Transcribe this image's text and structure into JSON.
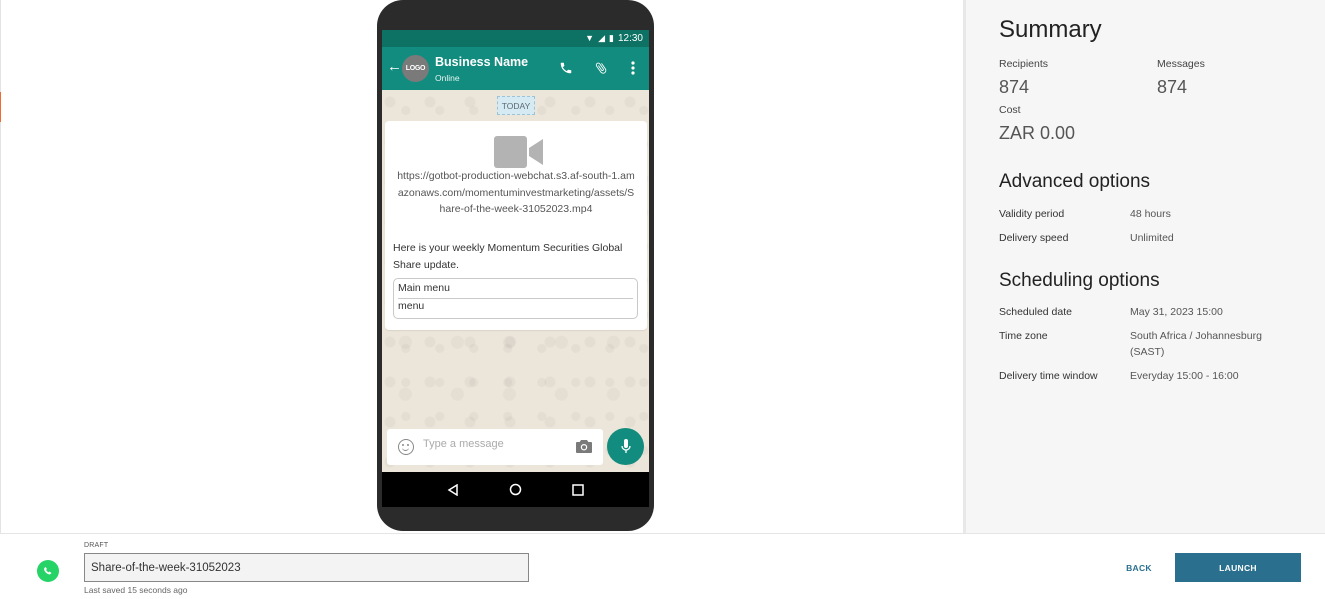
{
  "preview": {
    "status_time": "12:30",
    "business_name": "Business Name",
    "business_status": "Online",
    "avatar_text": "LOGO",
    "date_chip": "TODAY",
    "media_url": "https://gotbot-production-webchat.s3.af-south-1.amazonaws.com/momentuminvestmarketing/assets/Share-of-the-week-31052023.mp4",
    "message_text": "Here is your weekly Momentum Securities Global Share update.",
    "menu_title": "Main menu",
    "menu_item": "menu",
    "input_placeholder": "Type a message"
  },
  "summary": {
    "title": "Summary",
    "recipients_label": "Recipients",
    "recipients_value": "874",
    "messages_label": "Messages",
    "messages_value": "874",
    "cost_label": "Cost",
    "cost_value": "ZAR 0.00"
  },
  "advanced": {
    "title": "Advanced options",
    "validity_label": "Validity period",
    "validity_value": "48 hours",
    "speed_label": "Delivery speed",
    "speed_value": "Unlimited"
  },
  "scheduling": {
    "title": "Scheduling options",
    "date_label": "Scheduled date",
    "date_value": "May 31, 2023 15:00",
    "tz_label": "Time zone",
    "tz_value": "South Africa / Johannesburg (SAST)",
    "window_label": "Delivery time window",
    "window_value": "Everyday 15:00 - 16:00"
  },
  "footer": {
    "draft_label": "DRAFT",
    "campaign_name": "Share-of-the-week-31052023",
    "saved_text": "Last saved 15 seconds ago",
    "back_label": "BACK",
    "launch_label": "LAUNCH"
  },
  "colors": {
    "accent": "#2a6f8e",
    "whatsapp_header": "#128c7e",
    "whatsapp_green": "#25d366"
  }
}
